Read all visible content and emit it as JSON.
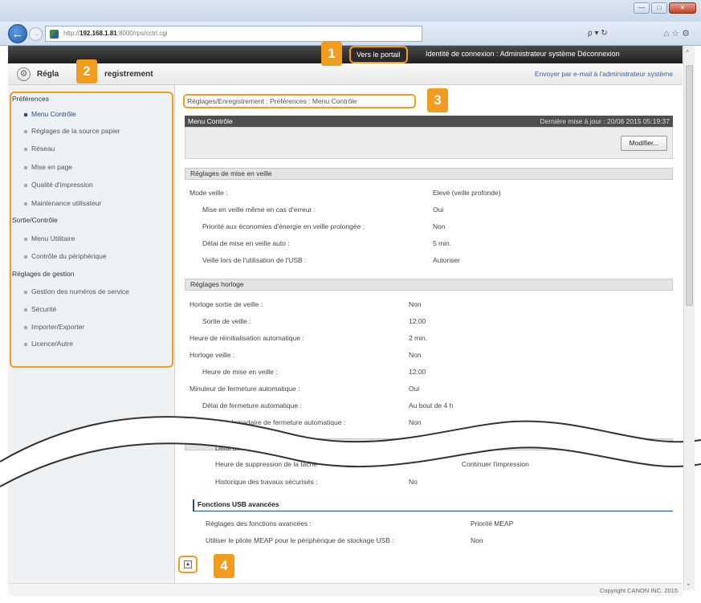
{
  "browser": {
    "url_prefix": "http://",
    "url_host": "192.168.1.81",
    "url_path": ":8000/rps/cctrl.cgi",
    "search_tools": "ρ ▾ ↻",
    "fav_icons": "⌂ ☆ ⚙"
  },
  "topbar": {
    "portal_label": "Vers le portail",
    "login_info": "Identité de connexion : Administrateur système Déconnexion"
  },
  "header": {
    "title_a": "Régla",
    "title_b": "registrement",
    "email_link": "Envoyer par e-mail à l'administrateur système"
  },
  "sidebar": {
    "sections": [
      {
        "label": "Préférences"
      },
      {
        "label": "Sortie/Contrôle"
      },
      {
        "label": "Réglages de gestion"
      }
    ],
    "items": [
      {
        "label": "Menu Contrôle"
      },
      {
        "label": "Réglages de la source papier"
      },
      {
        "label": "Réseau"
      },
      {
        "label": "Mise en page"
      },
      {
        "label": "Qualité d'impression"
      },
      {
        "label": "Maintenance utilisateur"
      },
      {
        "label": "Menu Utilitaire"
      },
      {
        "label": "Contrôle du périphérique"
      },
      {
        "label": "Gestion des numéros de service"
      },
      {
        "label": "Sécurité"
      },
      {
        "label": "Importer/Exporter"
      },
      {
        "label": "Licence/Autre"
      }
    ]
  },
  "main": {
    "breadcrumb": "Réglages/Enregistrement : Préférences : Menu Contrôle",
    "menu_title": "Menu Contrôle",
    "last_update": "Dernière mise à jour : 20/08 2015 05:19:37",
    "modify_label": "Modifier...",
    "sleep_section": "Réglages de mise en veille",
    "sleep_rows": [
      {
        "label": "Mode veille :",
        "value": "Elevé (veille profonde)"
      },
      {
        "label": "Mise en veille même en cas d'erreur :",
        "value": "Oui"
      },
      {
        "label": "Priorité aux économies d'énergie en veille prolongée :",
        "value": "Non"
      },
      {
        "label": "Délai de mise en veille auto :",
        "value": "5 min."
      },
      {
        "label": "Veille lors de l'utilisation de l'USB :",
        "value": "Autoriser"
      }
    ],
    "clock_section": "Réglages horloge",
    "clock_rows": [
      {
        "label": "Horloge sortie de veille :",
        "value": "Non"
      },
      {
        "label": "Sortie de veille :",
        "value": "12:00"
      },
      {
        "label": "Heure de réinitialisation automatique :",
        "value": "2 min."
      },
      {
        "label": "Horloge veille :",
        "value": "Non"
      },
      {
        "label": "Heure de mise en veille :",
        "value": "12:00"
      },
      {
        "label": "Minuteur de fermeture automatique :",
        "value": "Oui"
      },
      {
        "label": "Délai de fermeture automatique :",
        "value": "Au bout de 4 h"
      },
      {
        "label": "Minuteur hebdomadaire de fermeture automatique :",
        "value": "Non"
      }
    ],
    "lower_rows": [
      {
        "label": "Délai de suppress"
      },
      {
        "label": "Heure de suppression de la tâche",
        "value": "Continuer l'impression"
      },
      {
        "label": "Historique des travaux sécurisés :",
        "value": "No"
      }
    ],
    "usb_section": "Fonctions USB avancées",
    "usb_rows": [
      {
        "label": "Réglages des fonctions avancées :",
        "value": "Priorité MEAP"
      },
      {
        "label": "Utiliser le pilote MEAP pour le périphérique de stockage USB :",
        "value": "Non"
      }
    ]
  },
  "footer": {
    "copyright": "Copyright CANON INC. 2015"
  },
  "callouts": [
    "1",
    "2",
    "3",
    "4"
  ],
  "icons": {
    "back": "back-arrow-icon",
    "settings": "gear-icon",
    "top": "page-top-icon"
  },
  "colors": {
    "accent": "#f29c1f",
    "active_link": "#1d4f91"
  }
}
